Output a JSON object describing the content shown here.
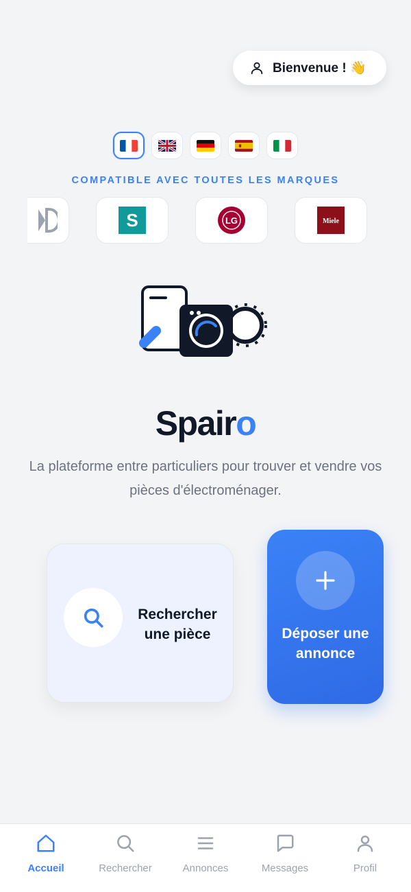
{
  "header": {
    "welcome_text": "Bienvenue ! 👋",
    "welcome_icon": "user-icon"
  },
  "languages": [
    {
      "code": "fr",
      "icon": "flag-france",
      "selected": true
    },
    {
      "code": "en",
      "icon": "flag-united-kingdom",
      "selected": false
    },
    {
      "code": "de",
      "icon": "flag-germany",
      "selected": false
    },
    {
      "code": "es",
      "icon": "flag-spain",
      "selected": false
    },
    {
      "code": "it",
      "icon": "flag-italy",
      "selected": false
    }
  ],
  "brands": {
    "heading": "COMPATIBLE AVEC TOUTES LES MARQUES",
    "items": [
      {
        "icon": "partial-brand-logo"
      },
      {
        "icon": "siemens-logo",
        "text": "S"
      },
      {
        "icon": "lg-logo",
        "text": "LG"
      },
      {
        "icon": "miele-logo",
        "text": "Miele"
      }
    ]
  },
  "hero": {
    "illustration": "phone-washing-machine-icon",
    "logo_main": "Spair",
    "logo_accent": "o",
    "tagline": "La plateforme entre particuliers pour trouver et vendre vos pièces d'électroménager."
  },
  "actions": {
    "search": {
      "label": "Rechercher une pièce",
      "icon": "search-icon"
    },
    "post": {
      "label": "Déposer une annonce",
      "icon": "plus-icon"
    }
  },
  "tabbar": {
    "items": [
      {
        "label": "Accueil",
        "icon": "home-icon",
        "active": true
      },
      {
        "label": "Rechercher",
        "icon": "search-icon",
        "active": false
      },
      {
        "label": "Annonces",
        "icon": "list-icon",
        "active": false
      },
      {
        "label": "Messages",
        "icon": "message-icon",
        "active": false
      },
      {
        "label": "Profil",
        "icon": "user-icon",
        "active": false
      }
    ]
  },
  "colors": {
    "accent": "#3b82f6",
    "background": "#f3f4f6",
    "text_dark": "#111827",
    "text_muted": "#6b7280",
    "tab_inactive": "#9ca3af",
    "siemens": "#109a9a",
    "lg": "#a50034",
    "miele": "#8c0f1a"
  }
}
